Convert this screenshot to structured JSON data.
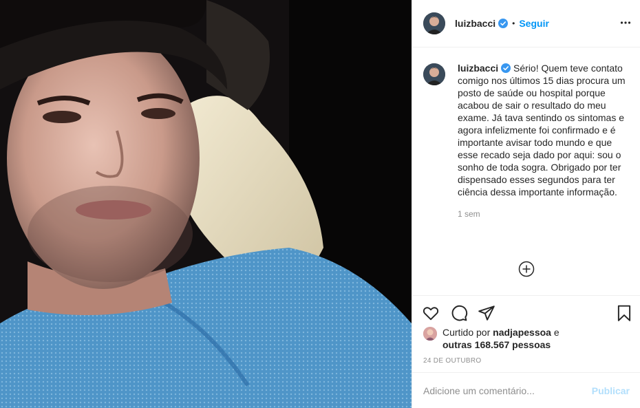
{
  "post": {
    "photo_alt": "selfie",
    "author": {
      "username": "luizbacci",
      "verified": true
    },
    "follow_label": "Seguir",
    "separator": "•",
    "caption": {
      "username": "luizbacci",
      "text": " Sério! Quem teve contato comigo nos últimos 15 dias procura um posto de saúde ou hospital porque acabou de sair o resultado do meu exame. Já tava sentindo os sintomas e agora infelizmente foi confirmado e é importante avisar todo mundo e que esse recado seja dado por aqui: sou o sonho de toda sogra. Obrigado por ter dispensado esses segundos para ter ciência dessa importante informação.",
      "time_ago": "1 sem"
    },
    "likes": {
      "prefix": "Curtido por ",
      "liker": "nadjapessoa",
      "conjunction": " e",
      "others": "outras 168.567 pessoas"
    },
    "date": "24 de outubro",
    "comment": {
      "placeholder": "Adicione um comentário...",
      "publish_label": "Publicar"
    }
  },
  "icons": {
    "more": "more-options-icon",
    "load_more": "load-more-comments-icon",
    "like": "heart-icon",
    "comment": "comment-icon",
    "share": "share-icon",
    "save": "bookmark-icon",
    "verified": "verified-badge-icon"
  },
  "colors": {
    "link": "#0095f6",
    "publish_disabled": "#b2dffc",
    "muted": "#8e8e8e",
    "verified": "#3897f0"
  }
}
